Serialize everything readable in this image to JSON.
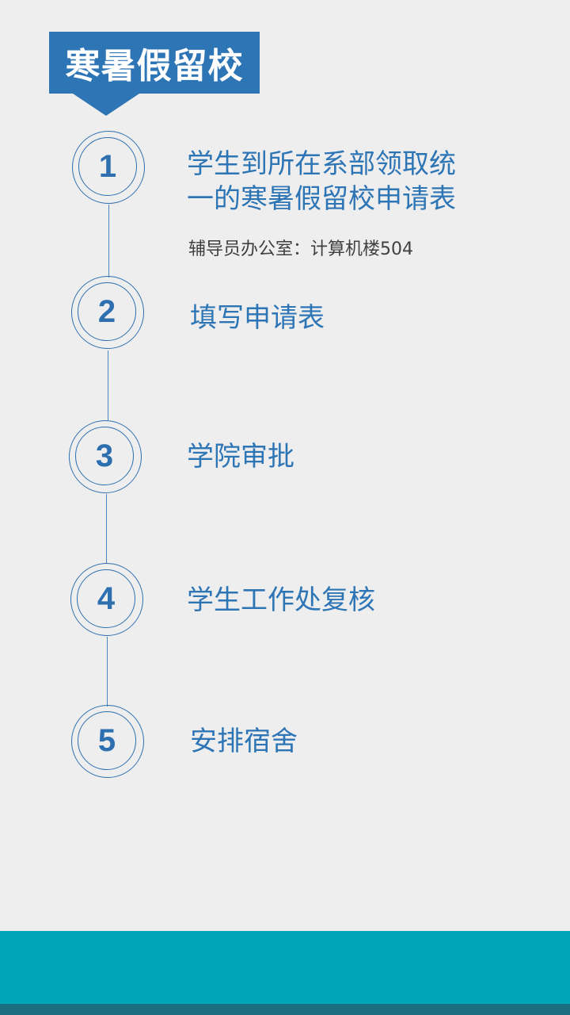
{
  "title": "寒暑假留校",
  "steps": [
    {
      "number": "1",
      "title_line1": "学生到所在系部领取统",
      "title_line2": "一的寒暑假留校申请表",
      "note": "辅导员办公室：计算机楼504"
    },
    {
      "number": "2",
      "title": "填写申请表"
    },
    {
      "number": "3",
      "title": "学院审批"
    },
    {
      "number": "4",
      "title": "学生工作处复核"
    },
    {
      "number": "5",
      "title": "安排宿舍"
    }
  ],
  "colors": {
    "accent": "#2e75b6",
    "circle_stroke": "#2e6fb0",
    "background": "#eeeeee",
    "footer_teal": "#00a5b8",
    "footer_dark": "#1a6e80"
  }
}
